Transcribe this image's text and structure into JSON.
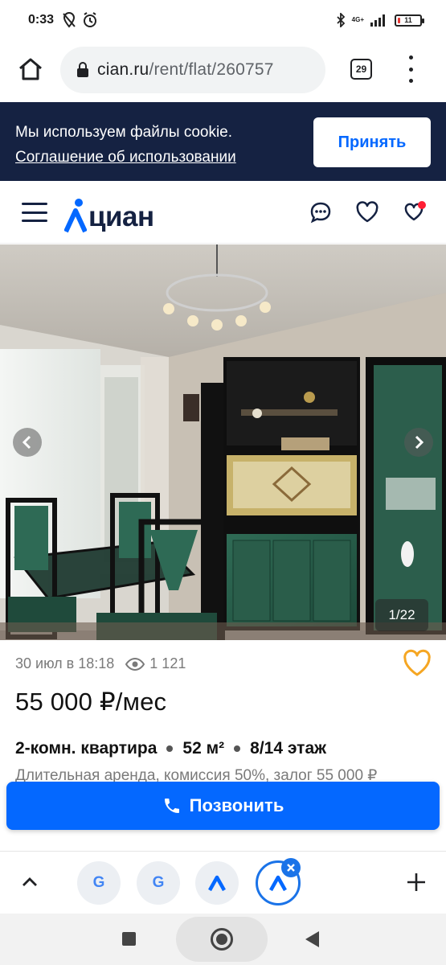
{
  "status_bar": {
    "time": "0:33",
    "network": "4G+",
    "battery": "11",
    "battery_level": 0.11
  },
  "browser": {
    "url_domain": "cian.ru",
    "url_path": "/rent/flat/260757",
    "tab_count": "29"
  },
  "cookie_banner": {
    "text": "Мы используем файлы cookie.",
    "link": "Соглашение об использовании",
    "accept_label": "Принять"
  },
  "site_header": {
    "logo_text": "циан"
  },
  "gallery": {
    "counter": "1/22"
  },
  "listing": {
    "date": "30 июл в 18:18",
    "views": "1 121",
    "price": "55 000 ₽/мес",
    "rooms": "2-комн. квартира",
    "area": "52 м²",
    "floor": "8/14 этаж",
    "terms": "Длительная аренда, комиссия 50%, залог 55 000 ₽"
  },
  "call_button": {
    "label": "Позвонить"
  },
  "tab_strip": {
    "tabs": [
      {
        "icon": "google-icon",
        "letter": "G"
      },
      {
        "icon": "google-icon",
        "letter": "G"
      },
      {
        "icon": "cian-icon"
      },
      {
        "icon": "cian-icon",
        "active": true
      }
    ]
  },
  "colors": {
    "brand_blue": "#0468ff",
    "cookie_bg": "#152242",
    "fav_orange": "#f5a623"
  }
}
